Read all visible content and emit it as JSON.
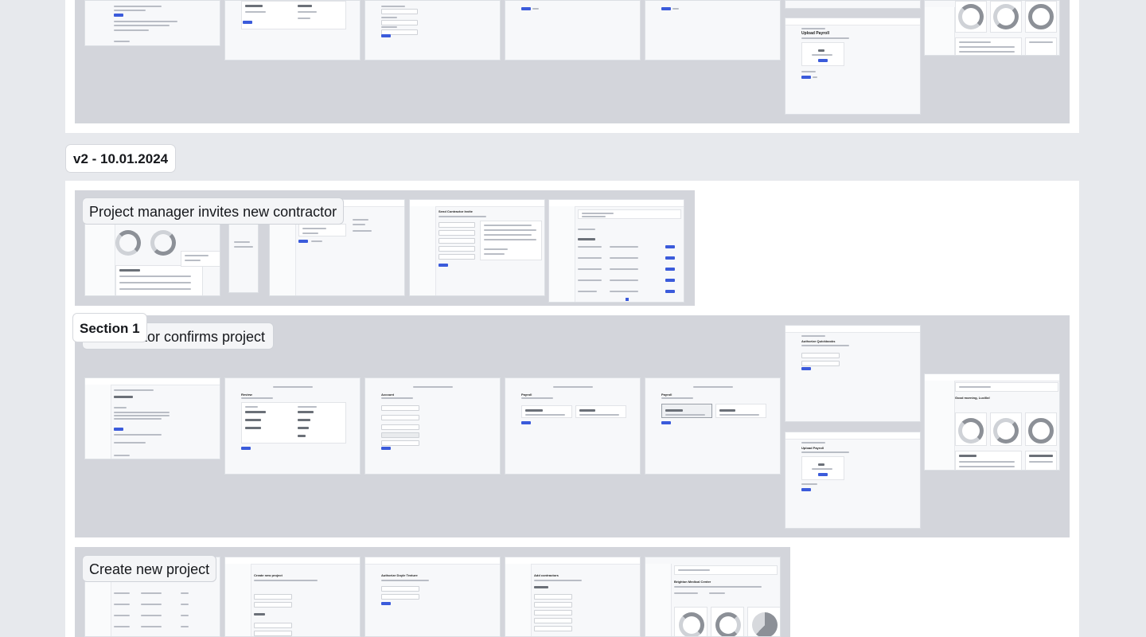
{
  "version_label": "v2 - 10.01.2024",
  "sections": {
    "invite": {
      "title": "Project manager invites new contractor"
    },
    "section1": {
      "title": "Section 1"
    },
    "confirm": {
      "title": "Contractor confirms project",
      "visible_title": "ctor confirms project"
    },
    "create": {
      "title": "Create new project"
    }
  },
  "frames": {
    "review_title": "Review",
    "account_title": "Account",
    "payroll_title": "Payroll",
    "payroll_title_2": "Payroll",
    "authorize_title": "Authorize Quickbooks",
    "upload_title": "Upload Payroll",
    "upload_title_top": "Upload Payroll",
    "greeting": "Good morning, Lucilla!",
    "send_invite_title": "Send Contractor Invite",
    "create_project_title": "Create new project",
    "authorize_doyle_title": "Authorize Doyle Texture",
    "add_contractors_title": "Add contractors",
    "brighton_title": "Brighton Medical Center"
  }
}
